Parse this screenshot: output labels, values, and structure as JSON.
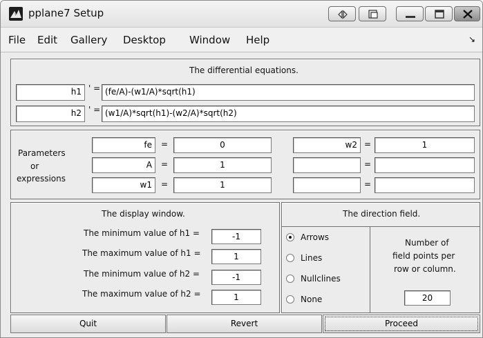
{
  "window": {
    "title": "pplane7 Setup"
  },
  "menu": {
    "items": [
      "File",
      "Edit",
      "Gallery",
      "Desktop",
      "Window",
      "Help"
    ],
    "dock_arrow": "↘"
  },
  "equations": {
    "heading": "The differential equations.",
    "rows": [
      {
        "var": "h1",
        "prime": "' =",
        "expr": "(fe/A)-(w1/A)*sqrt(h1)"
      },
      {
        "var": "h2",
        "prime": "' =",
        "expr": "(w1/A)*sqrt(h1)-(w2/A)*sqrt(h2)"
      }
    ]
  },
  "parameters": {
    "label_lines": [
      "Parameters",
      "or",
      "expressions"
    ],
    "left": [
      {
        "name": "fe",
        "eq": "=",
        "value": "0"
      },
      {
        "name": "A",
        "eq": "=",
        "value": "1"
      },
      {
        "name": "w1",
        "eq": "=",
        "value": "1"
      }
    ],
    "right": [
      {
        "name": "w2",
        "eq": "=",
        "value": "1"
      },
      {
        "name": "",
        "eq": "=",
        "value": ""
      },
      {
        "name": "",
        "eq": "=",
        "value": ""
      }
    ]
  },
  "display_window": {
    "heading": "The display window.",
    "rows": [
      {
        "label": "The minimum value of h1 =",
        "value": "-1"
      },
      {
        "label": "The maximum value of h1 =",
        "value": "1"
      },
      {
        "label": "The minimum value of h2 =",
        "value": "-1"
      },
      {
        "label": "The maximum value of h2 =",
        "value": "1"
      }
    ]
  },
  "direction_field": {
    "heading": "The direction field.",
    "options": [
      "Arrows",
      "Lines",
      "Nullclines",
      "None"
    ],
    "selected": "Arrows",
    "points_label": [
      "Number of",
      "field points per",
      "row or column."
    ],
    "points_value": "20"
  },
  "buttons": {
    "quit": "Quit",
    "revert": "Revert",
    "proceed": "Proceed"
  }
}
